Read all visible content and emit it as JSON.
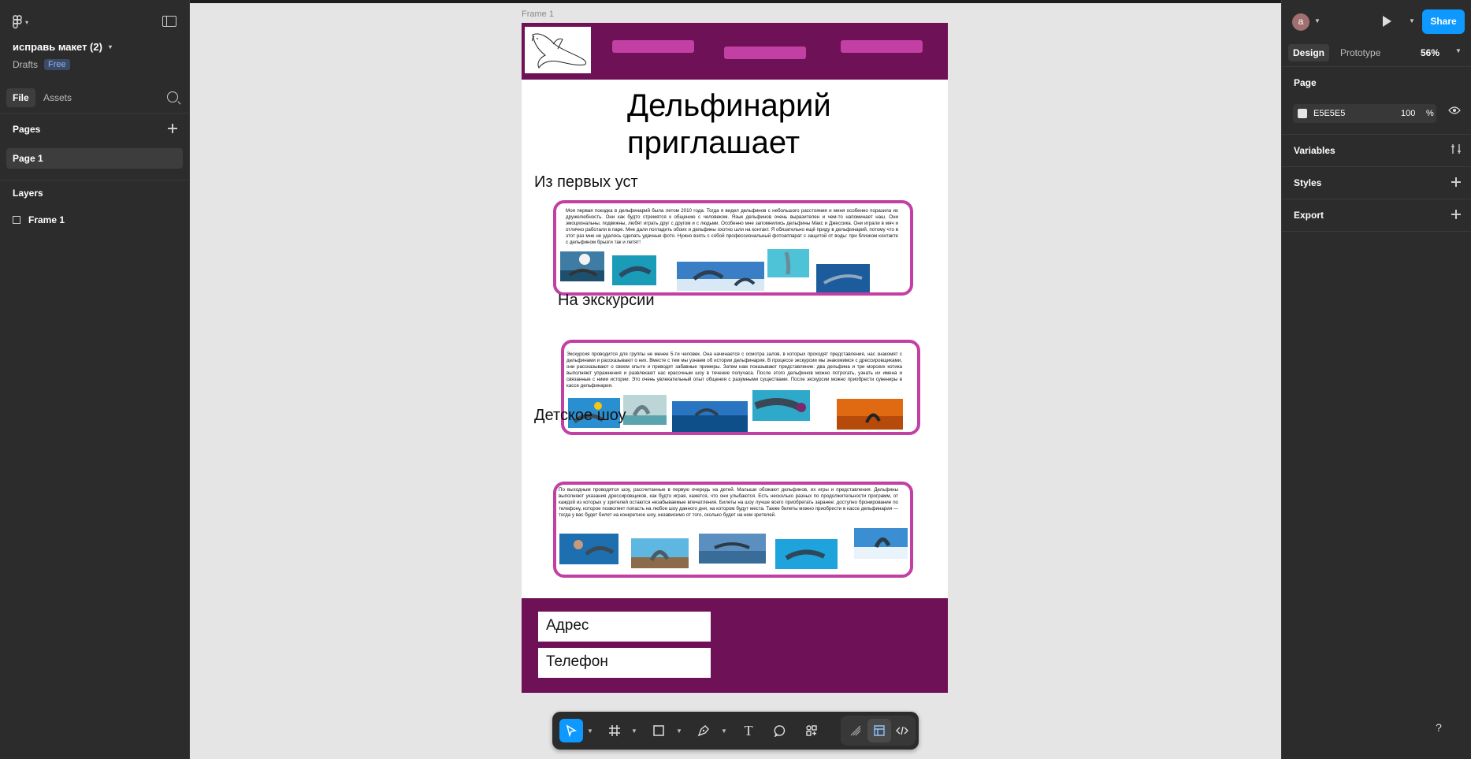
{
  "left_panel": {
    "file_name": "исправь макет (2)",
    "location": "Drafts",
    "plan_badge": "Free",
    "tabs": [
      {
        "label": "File"
      },
      {
        "label": "Assets"
      }
    ],
    "pages_title": "Pages",
    "pages": [
      {
        "label": "Page 1"
      }
    ],
    "layers_title": "Layers",
    "layers": [
      {
        "label": "Frame 1"
      }
    ]
  },
  "canvas": {
    "frame_label": "Frame 1",
    "background_color": "#E5E5E5",
    "site": {
      "title": "Дельфинарий приглашает",
      "header_color": "#6E1157",
      "accent_color": "#C23FA4",
      "sections": [
        {
          "heading": "Из первых уст",
          "text": "Моя первая поездка в дельфинарий была летом 2010 года. Тогда я видел дельфинов с небольшого расстояния и меня особенно поразила их дружелюбность. Они как будто стремятся к общению с человеком. Язык дельфинов очень выразителен и чем-то напоминает наш. Они эмоциональны, подвижны, любят играть друг с другом и с людьми. Особенно мне запомнились дельфины Макс и Джессика. Они играли в мяч и отлично работали в паре. Мне дали погладить обоих и дельфины охотно шли на контакт. Я обязательно ещё приду в дельфинарий, потому что в этот раз мне не удалось сделать удачные фото. Нужно взять с собой профессиональный фотоаппарат с защитой от воды: при близком контакте с дельфином брызги так и летят!"
        },
        {
          "heading": "На экскурсии",
          "text": "Экскурсия проводится для группы не менее 5-ти человек. Она начинается с осмотра залов, в которых проходят представления, нас знакомят с дельфинами и рассказывают о них. Вместе с тем мы узнаем об истории дельфинария. В процессе экскурсии мы знакомимся с дрессировщиками, они рассказывают о своем опыте и приводят забавные примеры. Затем нам показывают представление: два дельфина и три морских котика выполняют упражнения и развлекают нас красочным шоу в течение получаса. После этого дельфинов можно потрогать, узнать их имена и связанные с ними истории. Это очень увлекательный опыт общения с разумными существами. После экскурсии можно приобрести сувениры в кассе дельфинария."
        },
        {
          "heading": "Детское шоу",
          "text": "По выходным проводятся шоу, рассчитанные в первую очередь на детей. Малыши обожают дельфинов, их игры и представления. Дельфины выполняют указания дрессировщиков, как будто играя, кажется, что они улыбаются. Есть несколько разных по продолжительности программ, от каждой из которых у зрителей остаются незабываемые впечатления. Билеты на шоу лучше всего приобретать заранее: доступно бронирование по телефону, которое позволяет попасть на любое шоу данного дня, на котором будут места. Также билеты можно приобрести в кассе дельфинария — тогда у вас будет билет на конкретное шоу, независимо от того, сколько будет на нем зрителей."
        }
      ],
      "footer": {
        "address_label": "Адрес",
        "phone_label": "Телефон"
      }
    }
  },
  "toolbar": {
    "tools": [
      "move-tool",
      "frame-tool",
      "shape-tool",
      "pen-tool",
      "text-tool",
      "comment-tool",
      "actions-tool",
      "draw-mode",
      "design-mode",
      "dev-mode"
    ]
  },
  "right_panel": {
    "avatar_initial": "a",
    "share_label": "Share",
    "tabs": [
      {
        "label": "Design"
      },
      {
        "label": "Prototype"
      }
    ],
    "zoom": "56%",
    "page_section": "Page",
    "page_color": "E5E5E5",
    "page_opacity": "100",
    "page_opacity_unit": "%",
    "variables_label": "Variables",
    "styles_label": "Styles",
    "export_label": "Export"
  },
  "help_label": "?"
}
